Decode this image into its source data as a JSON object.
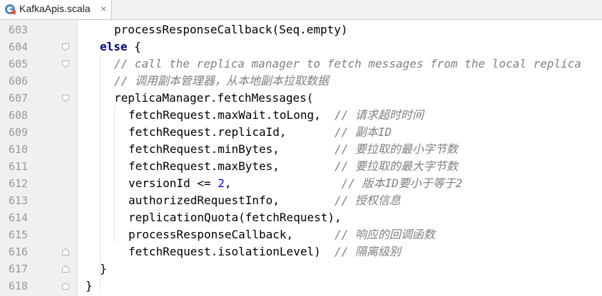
{
  "tab": {
    "label": "KafkaApis.scala",
    "close": "×",
    "icon": "scala-file-icon"
  },
  "colors": {
    "keyword": "#000080",
    "comment": "#808080",
    "number": "#0000ff",
    "line_number": "#999999"
  },
  "lines": [
    {
      "num": "603",
      "indent": 3,
      "parts": [
        {
          "t": "processResponseCallback(Seq.empty)",
          "c": ""
        }
      ]
    },
    {
      "num": "604",
      "indent": 2,
      "parts": [
        {
          "t": "else",
          "c": "kw"
        },
        {
          "t": " {",
          "c": ""
        }
      ]
    },
    {
      "num": "605",
      "indent": 3,
      "parts": [
        {
          "t": "// call the replica manager to fetch messages from the local replica",
          "c": "cmt"
        }
      ]
    },
    {
      "num": "606",
      "indent": 3,
      "parts": [
        {
          "t": "// 调用副本管理器，从本地副本拉取数据",
          "c": "cmt"
        }
      ]
    },
    {
      "num": "607",
      "indent": 3,
      "parts": [
        {
          "t": "replicaManager.fetchMessages(",
          "c": ""
        }
      ]
    },
    {
      "num": "608",
      "indent": 4,
      "parts": [
        {
          "t": "fetchRequest.maxWait.toLong,  ",
          "c": ""
        },
        {
          "t": "// 请求超时时间",
          "c": "cmt"
        }
      ]
    },
    {
      "num": "609",
      "indent": 4,
      "parts": [
        {
          "t": "fetchRequest.replicaId,       ",
          "c": ""
        },
        {
          "t": "// 副本ID",
          "c": "cmt"
        }
      ]
    },
    {
      "num": "610",
      "indent": 4,
      "parts": [
        {
          "t": "fetchRequest.minBytes,        ",
          "c": ""
        },
        {
          "t": "// 要拉取的最小字节数",
          "c": "cmt"
        }
      ]
    },
    {
      "num": "611",
      "indent": 4,
      "parts": [
        {
          "t": "fetchRequest.maxBytes,        ",
          "c": ""
        },
        {
          "t": "// 要拉取的最大字节数",
          "c": "cmt"
        }
      ]
    },
    {
      "num": "612",
      "indent": 4,
      "parts": [
        {
          "t": "versionId <= ",
          "c": ""
        },
        {
          "t": "2",
          "c": "num"
        },
        {
          "t": ",                ",
          "c": ""
        },
        {
          "t": "// 版本ID要小于等于2",
          "c": "cmt"
        }
      ]
    },
    {
      "num": "613",
      "indent": 4,
      "parts": [
        {
          "t": "authorizedRequestInfo,        ",
          "c": ""
        },
        {
          "t": "// 授权信息",
          "c": "cmt"
        }
      ]
    },
    {
      "num": "614",
      "indent": 4,
      "parts": [
        {
          "t": "replicationQuota(fetchRequest),",
          "c": ""
        }
      ]
    },
    {
      "num": "615",
      "indent": 4,
      "parts": [
        {
          "t": "processResponseCallback,      ",
          "c": ""
        },
        {
          "t": "// 响应的回调函数",
          "c": "cmt"
        }
      ]
    },
    {
      "num": "616",
      "indent": 4,
      "parts": [
        {
          "t": "fetchRequest.isolationLevel)  ",
          "c": ""
        },
        {
          "t": "// 隔离级别",
          "c": "cmt"
        }
      ]
    },
    {
      "num": "617",
      "indent": 2,
      "parts": [
        {
          "t": "}",
          "c": ""
        }
      ]
    },
    {
      "num": "618",
      "indent": 1,
      "parts": [
        {
          "t": "}",
          "c": ""
        }
      ]
    }
  ],
  "folds": [
    {
      "line": 1,
      "type": "open",
      "icon": "fold-open-icon"
    },
    {
      "line": 2,
      "type": "open",
      "icon": "fold-open-icon"
    },
    {
      "line": 4,
      "type": "open",
      "icon": "fold-open-icon"
    },
    {
      "line": 13,
      "type": "close",
      "icon": "fold-close-icon"
    },
    {
      "line": 14,
      "type": "close",
      "icon": "fold-close-icon"
    },
    {
      "line": 15,
      "type": "close",
      "icon": "fold-close-icon"
    }
  ]
}
